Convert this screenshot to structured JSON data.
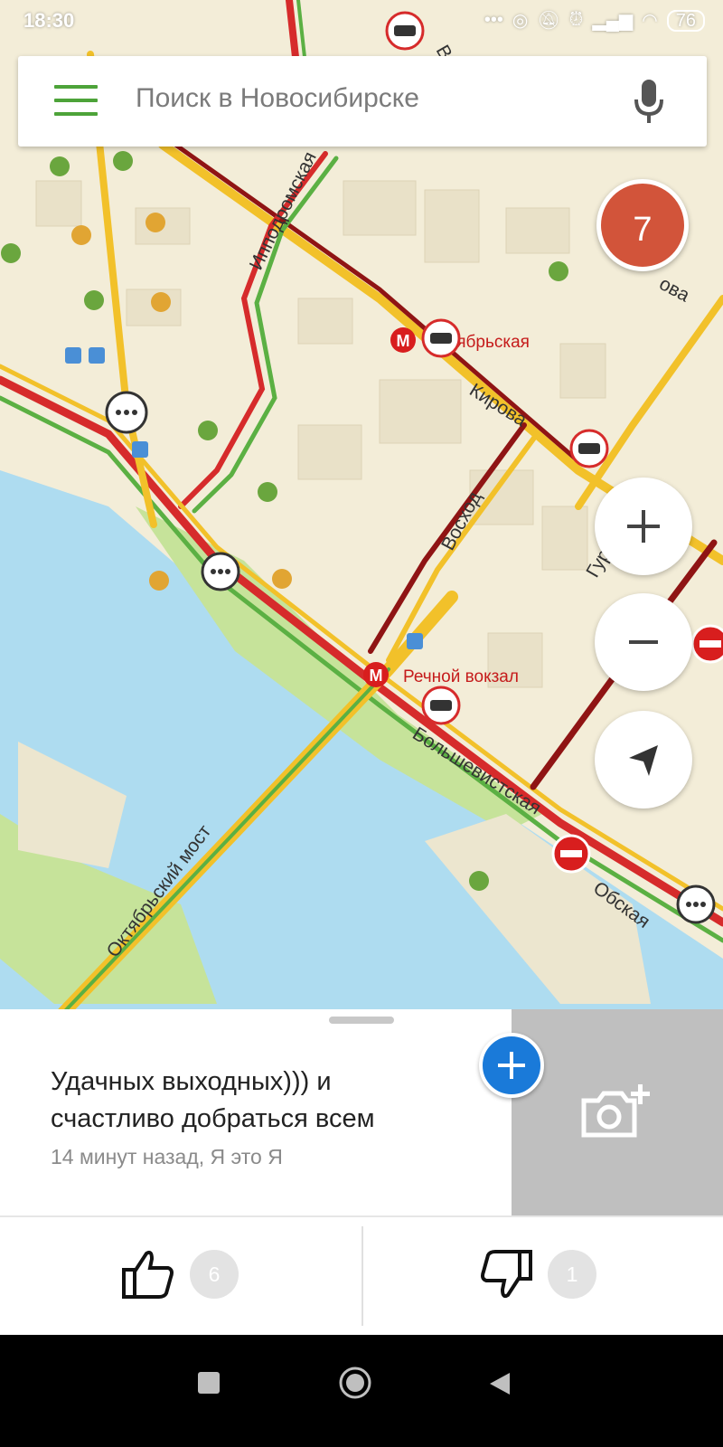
{
  "status_bar": {
    "time": "18:30",
    "icons": [
      "more-dots-icon",
      "hotspot-icon",
      "mute-bell-icon",
      "alarm-icon",
      "signal-icon",
      "wifi-icon"
    ],
    "battery": "76"
  },
  "search": {
    "placeholder": "Поиск в Новосибирске"
  },
  "map": {
    "badge_count": "7",
    "streets": [
      "Ипподромская",
      "Кирова",
      "Восход",
      "Гурьевская",
      "Большевистская",
      "Октябрьский мост",
      "Обская",
      "ова",
      "Во"
    ],
    "metro_stations": [
      "ктябрьская",
      "Речной вокзал"
    ],
    "colors": {
      "road_red": "#d62b2b",
      "road_darkred": "#8f1414",
      "road_yellow": "#f2c12a",
      "road_green": "#5bb043",
      "water": "#aedcf0",
      "park": "#c6e39a"
    }
  },
  "post": {
    "text_line1": "Удачных выходных)))  и",
    "text_line2": "счастливо добраться всем",
    "meta": "14 минут назад, Я это Я",
    "likes": "6",
    "dislikes": "1"
  }
}
